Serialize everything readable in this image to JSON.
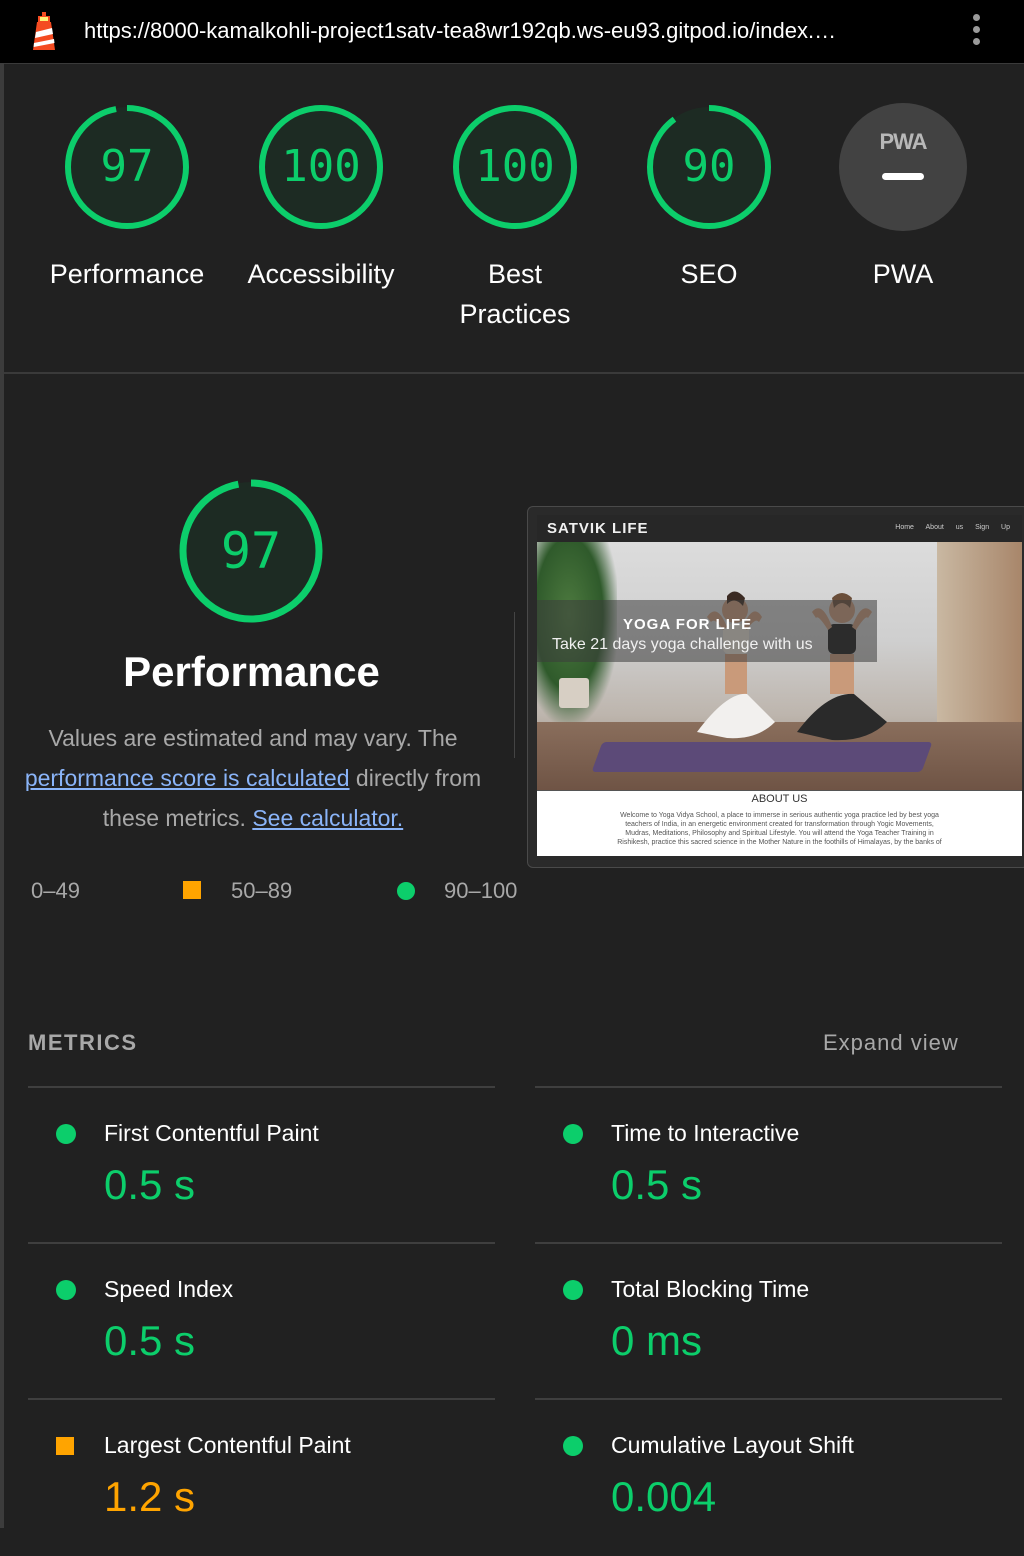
{
  "browser": {
    "url": "https://8000-kamalkohli-project1satv-tea8wr192qb.ws-eu93.gitpod.io/index.…"
  },
  "colors": {
    "pass": "#0cce6b",
    "average": "#ffa400",
    "fail": "#ff4e42",
    "background": "#212121",
    "link": "#8ab4f8"
  },
  "categories": [
    {
      "label": "Performance",
      "score": 97
    },
    {
      "label": "Accessibility",
      "score": 100
    },
    {
      "label": "Best Practices",
      "label_line1": "Best",
      "label_line2": "Practices",
      "score": 100
    },
    {
      "label": "SEO",
      "score": 90
    },
    {
      "label": "PWA",
      "score": null,
      "badge": "PWA"
    }
  ],
  "performance": {
    "score": 97,
    "title": "Performance",
    "desc_part1": "Values are estimated and may vary. The",
    "desc_link1": "performance score is calculated",
    "desc_part2": " directly from",
    "desc_part3": "these metrics. ",
    "desc_link2": "See calculator."
  },
  "screenshot": {
    "brand": "SATVIK LIFE",
    "nav_links": "Home About us Sign Up",
    "hero_title": "YOGA FOR LIFE",
    "hero_subtitle": "Take 21 days yoga challenge with us",
    "about_title": "ABOUT US",
    "about_text": "Welcome to Yoga Vidya School, a place to immerse in serious authentic yoga practice led by best yoga teachers of India, in an energetic environment created for transformation through Yogic Movements, Mudras, Meditations, Philosophy and Spiritual Lifestyle. You will attend the Yoga Teacher Training in Rishikesh, practice this sacred science in the Mother Nature in the foothills of Himalayas, by the banks of"
  },
  "legend": {
    "fail": "0–49",
    "average": "50–89",
    "pass": "90–100"
  },
  "metrics": {
    "header": "METRICS",
    "expand": "Expand view",
    "items": [
      {
        "label": "First Contentful Paint",
        "value": "0.5 s",
        "rating": "pass"
      },
      {
        "label": "Time to Interactive",
        "value": "0.5 s",
        "rating": "pass"
      },
      {
        "label": "Speed Index",
        "value": "0.5 s",
        "rating": "pass"
      },
      {
        "label": "Total Blocking Time",
        "value": "0 ms",
        "rating": "pass"
      },
      {
        "label": "Largest Contentful Paint",
        "value": "1.2 s",
        "rating": "average"
      },
      {
        "label": "Cumulative Layout Shift",
        "value": "0.004",
        "rating": "pass"
      }
    ]
  }
}
